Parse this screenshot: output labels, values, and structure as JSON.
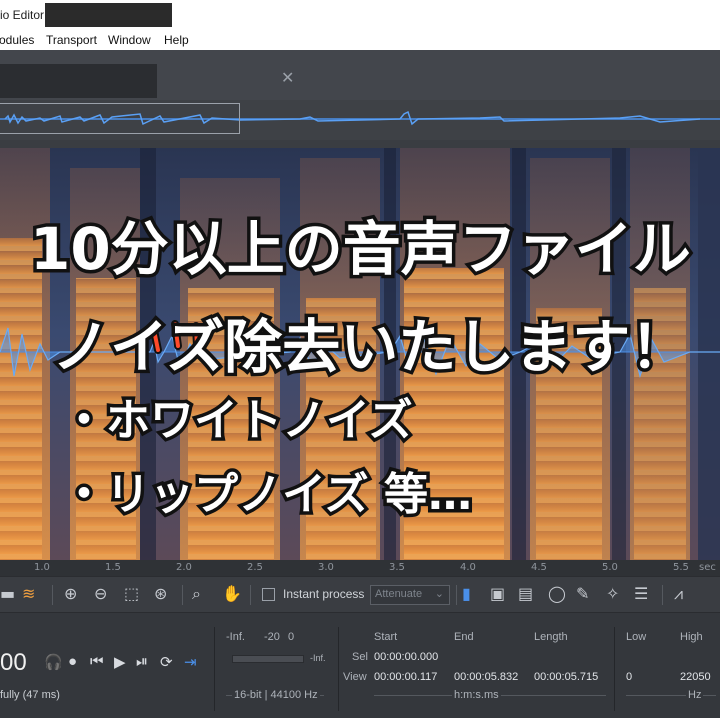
{
  "window": {
    "title": "io Editor"
  },
  "menu": {
    "items": [
      "odules",
      "Transport",
      "Window",
      "Help"
    ]
  },
  "overlay": {
    "emphasis": "〃",
    "headline1": "10分以上の音声ファイル",
    "headline2": "ノイズ除去いたします！",
    "bullet1": "・ホワイトノイズ",
    "bullet2": "・リップノイズ 等…"
  },
  "ruler": {
    "ticks": [
      "1.0",
      "1.5",
      "2.0",
      "2.5",
      "3.0",
      "3.5",
      "4.0",
      "4.5",
      "5.0",
      "5.5",
      "sec"
    ]
  },
  "toolbar": {
    "instant_process_label": "Instant process",
    "mode_value": "Attenuate"
  },
  "transport": {
    "time_display": "00",
    "status": "fully (47 ms)"
  },
  "meter": {
    "scale_inf": "-Inf.",
    "scale_20": "-20",
    "scale_0": "0",
    "readout": "-Inf.",
    "format": "16-bit | 44100 Hz"
  },
  "selection": {
    "col_start": "Start",
    "col_end": "End",
    "col_length": "Length",
    "row_sel": "Sel",
    "row_view": "View",
    "sel_start": "00:00:00.000",
    "view_start": "00:00:00.117",
    "view_end": "00:00:05.832",
    "view_length": "00:00:05.715",
    "units": "h:m:s.ms"
  },
  "frequency": {
    "col_low": "Low",
    "col_high": "High",
    "low": "0",
    "high": "22050",
    "units": "Hz"
  },
  "colors": {
    "accent": "#4a8fe8",
    "spectro_hot": "#f08a2a",
    "spectro_cold": "#1d2c4a"
  }
}
